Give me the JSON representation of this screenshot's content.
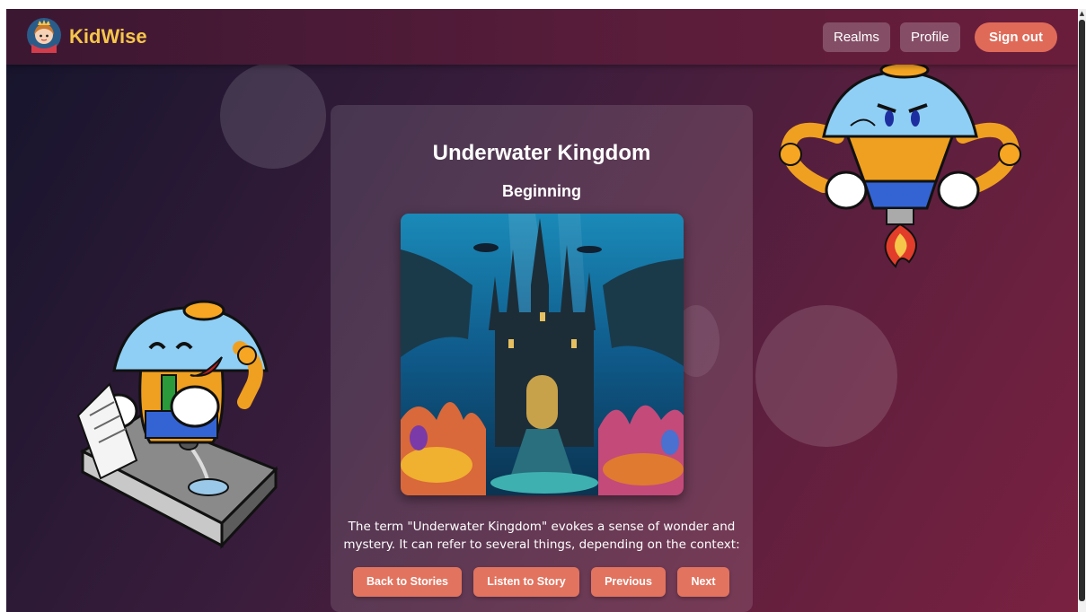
{
  "app": {
    "brand_name": "KidWise",
    "logo_icon": "princess-logo-icon"
  },
  "nav": {
    "realms_label": "Realms",
    "profile_label": "Profile",
    "signout_label": "Sign out"
  },
  "story": {
    "title": "Underwater Kingdom",
    "chapter": "Beginning",
    "image_icon": "underwater-castle-illustration",
    "text": "The term \"Underwater Kingdom\" evokes a sense of wonder and mystery. It can refer to several things, depending on the context:"
  },
  "actions": {
    "back_label": "Back to Stories",
    "listen_label": "Listen to Story",
    "previous_label": "Previous",
    "next_label": "Next"
  },
  "mascots": {
    "left": "laughing-robot-reporter-icon",
    "right": "angry-rocket-robot-icon"
  },
  "colors": {
    "accent": "#e2735f",
    "brand": "#f6c64a",
    "background": "#3a1d3c"
  }
}
